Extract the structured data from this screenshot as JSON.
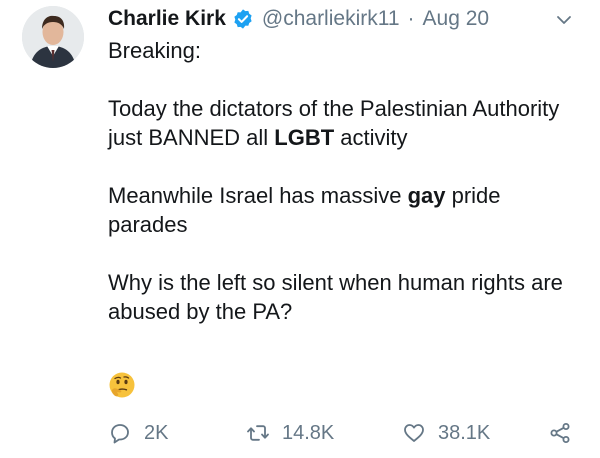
{
  "tweet": {
    "author": {
      "name": "Charlie Kirk",
      "handle": "@charliekirk11",
      "separator": "·",
      "date": "Aug 20",
      "verified_icon": "verified-badge-icon",
      "avatar": "avatar-photo"
    },
    "text": {
      "line_breaking": "Breaking:",
      "p1_a": "Today the dictators of the Palestinian Authority just BANNED all ",
      "p1_bold": "LGBT",
      "p1_b": " activity",
      "p2_a": "Meanwhile Israel has massive ",
      "p2_bold": "gay",
      "p2_b": " pride parades",
      "p3": "Why is the left so silent when human rights are abused by the PA?",
      "emoji": "thinking-face"
    },
    "actions": {
      "replies": "2K",
      "retweets": "14.8K",
      "likes": "38.1K"
    },
    "colors": {
      "verified": "#1da1f2",
      "muted": "#657786",
      "text": "#14171a"
    }
  }
}
